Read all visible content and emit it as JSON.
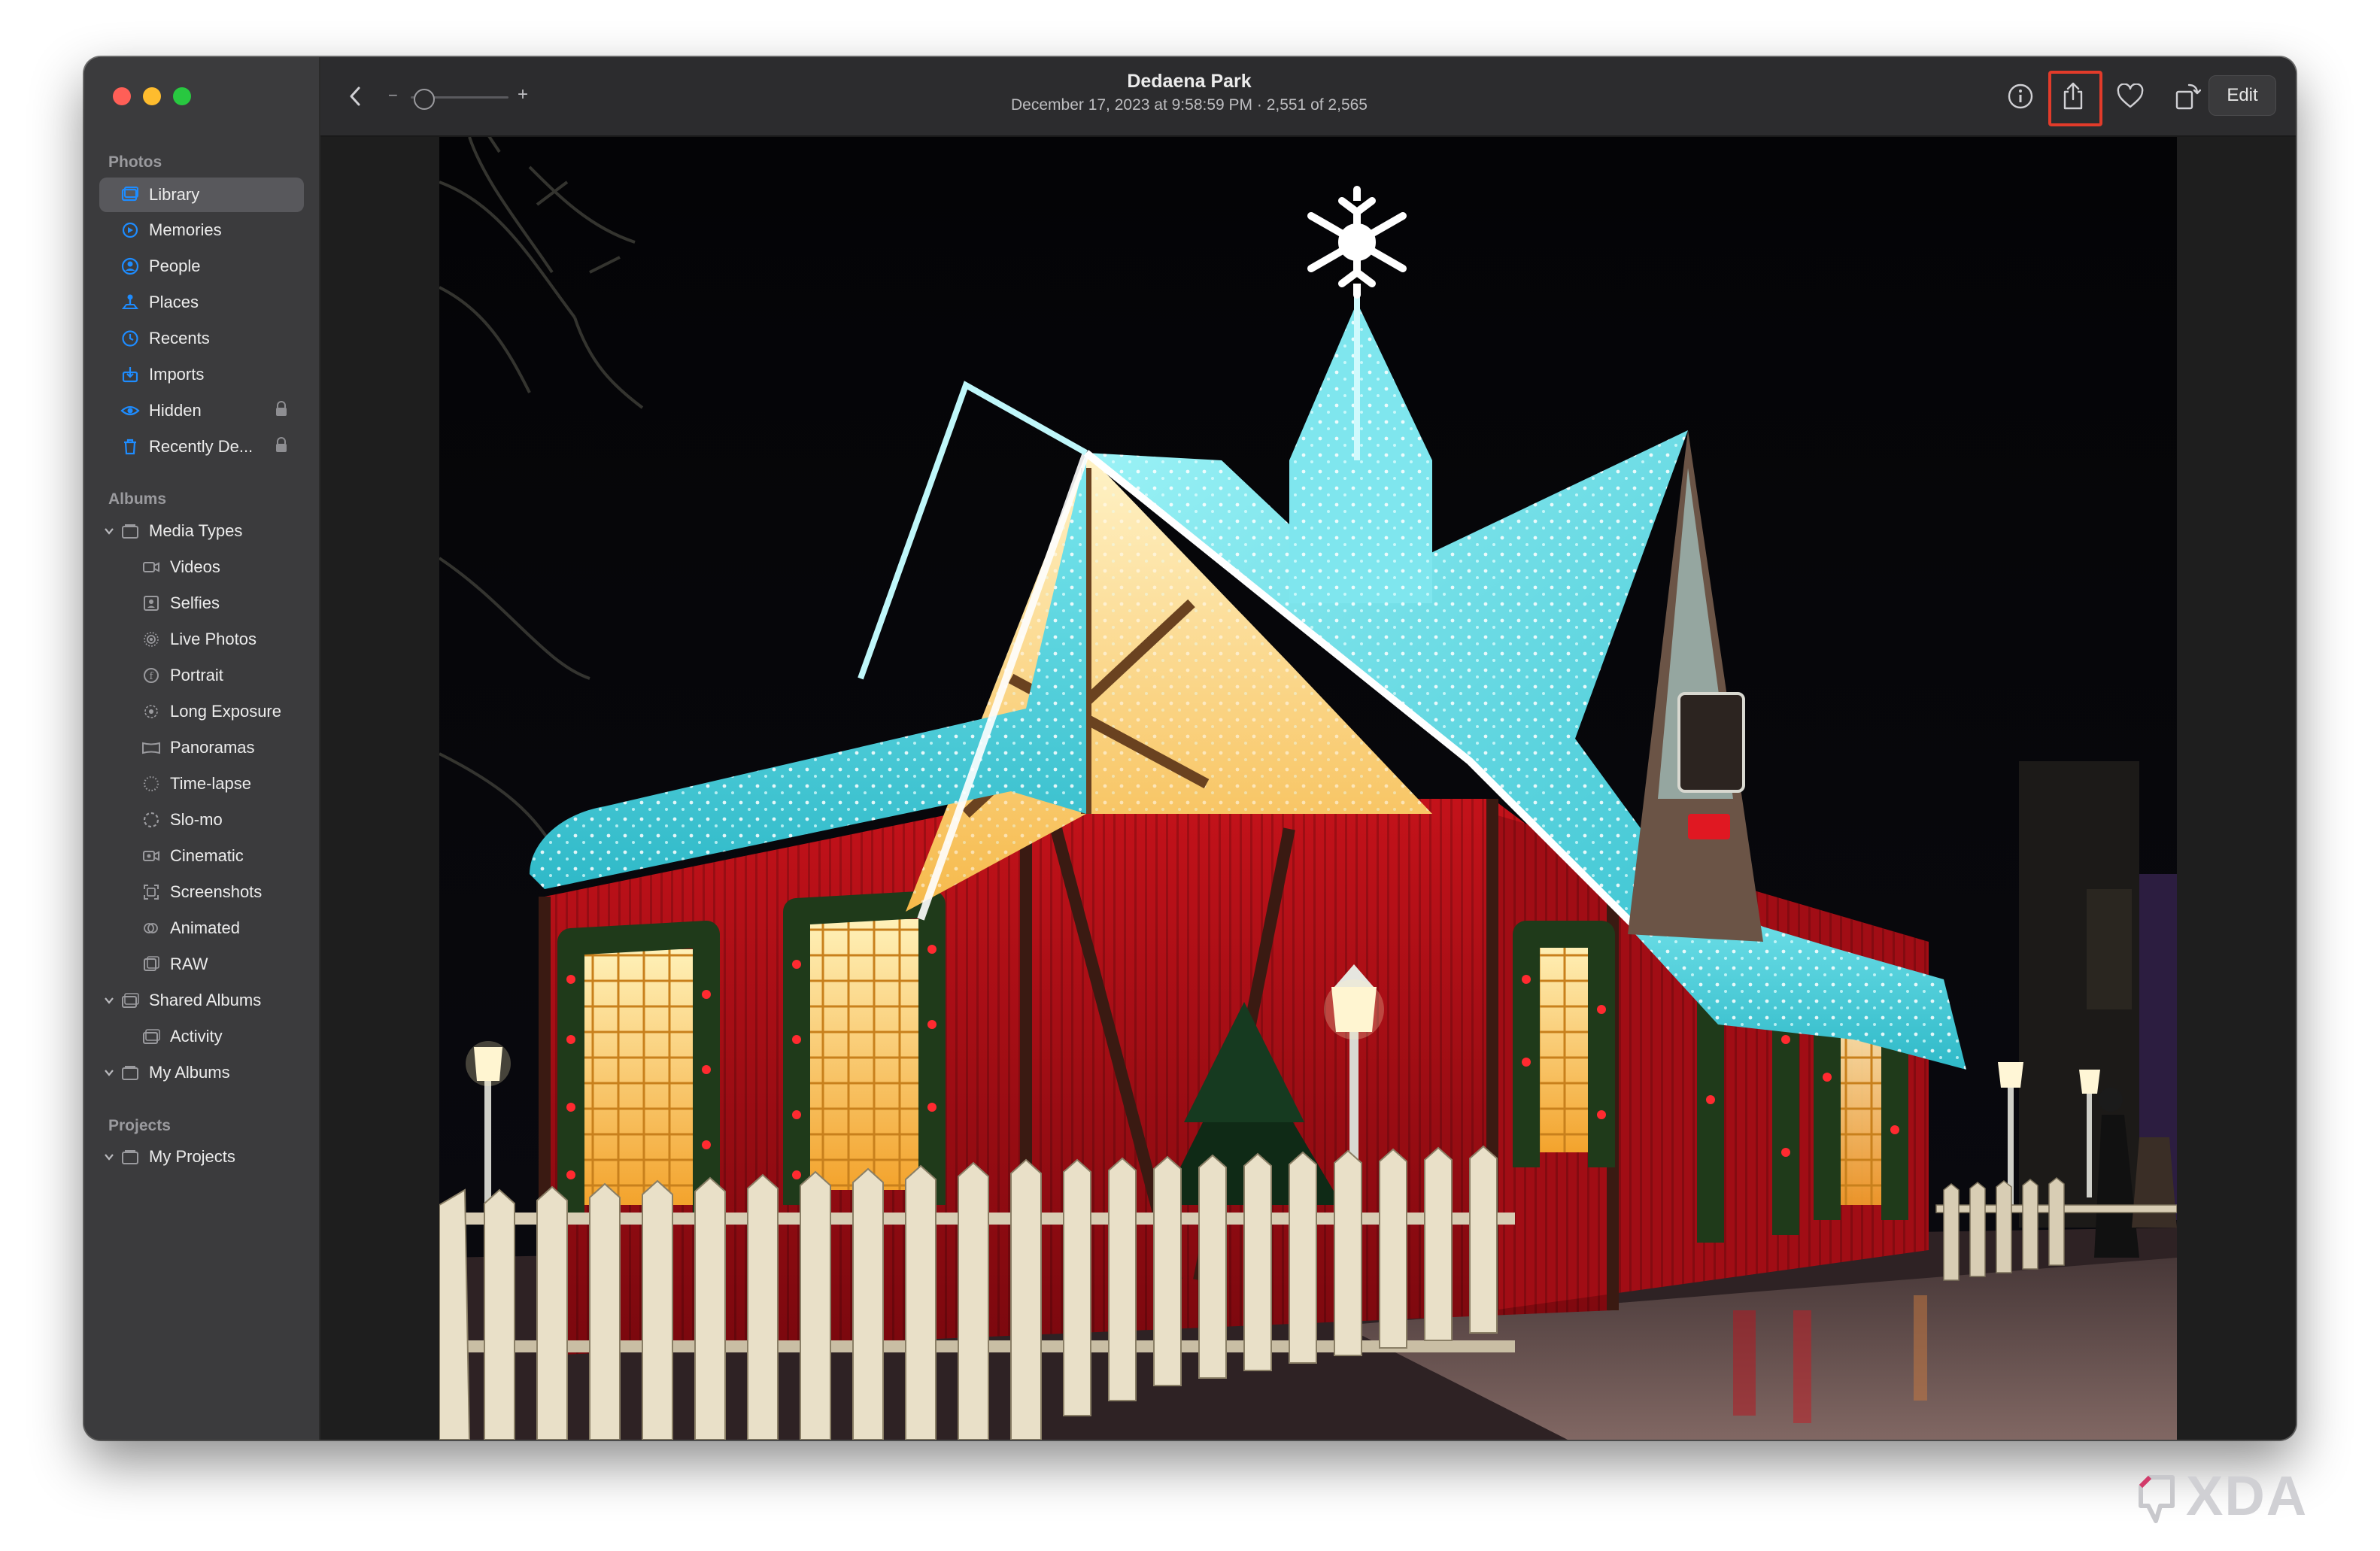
{
  "sidebar": {
    "photos_label": "Photos",
    "albums_label": "Albums",
    "projects_label": "Projects",
    "library": [
      {
        "label": "Library",
        "icon": "library-icon"
      },
      {
        "label": "Memories",
        "icon": "memories-icon"
      },
      {
        "label": "People",
        "icon": "people-icon"
      },
      {
        "label": "Places",
        "icon": "places-icon"
      },
      {
        "label": "Recents",
        "icon": "recents-icon"
      },
      {
        "label": "Imports",
        "icon": "imports-icon"
      },
      {
        "label": "Hidden",
        "icon": "hidden-icon"
      },
      {
        "label": "Recently De...",
        "icon": "trash-icon"
      }
    ],
    "media_types_label": "Media Types",
    "media_types": [
      {
        "label": "Videos"
      },
      {
        "label": "Selfies"
      },
      {
        "label": "Live Photos"
      },
      {
        "label": "Portrait"
      },
      {
        "label": "Long Exposure"
      },
      {
        "label": "Panoramas"
      },
      {
        "label": "Time-lapse"
      },
      {
        "label": "Slo-mo"
      },
      {
        "label": "Cinematic"
      },
      {
        "label": "Screenshots"
      },
      {
        "label": "Animated"
      },
      {
        "label": "RAW"
      }
    ],
    "shared_albums_label": "Shared Albums",
    "activity_label": "Activity",
    "my_albums_label": "My Albums",
    "my_projects_label": "My Projects"
  },
  "toolbar": {
    "title": "Dedaena Park",
    "subtitle": "December 17, 2023 at 9:58:59 PM  ·  2,551 of 2,565",
    "zoom_minus": "−",
    "zoom_plus": "+",
    "edit_label": "Edit"
  },
  "watermark": "XDA",
  "colors": {
    "accent": "#1e8cff",
    "highlight": "#e23b2a"
  }
}
